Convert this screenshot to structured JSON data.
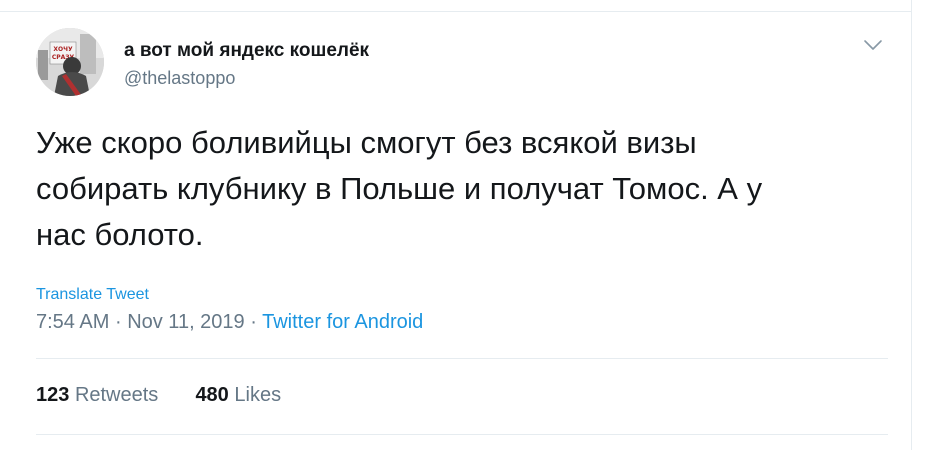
{
  "user": {
    "display_name": "а вот мой яндекс кошелёк",
    "handle": "@thelastoppo",
    "avatar_sign_text": "ХОЧУ СРАЗУ"
  },
  "tweet": {
    "lines": [
      "Уже скоро боливийцы смогут без всякой визы",
      "собирать клубнику в Польше и получат Томос. А у",
      "нас болото."
    ],
    "translate_label": "Translate Tweet",
    "time": "7:54 AM",
    "date": "Nov 11, 2019",
    "separator": "·",
    "source": "Twitter for Android"
  },
  "stats": {
    "retweets_count": "123",
    "retweets_label": "Retweets",
    "likes_count": "480",
    "likes_label": "Likes"
  },
  "icons": {
    "menu": "chevron-down-icon"
  },
  "colors": {
    "link": "#1b95e0",
    "muted": "#657786",
    "text": "#14171a",
    "rule": "#e6ecf0"
  }
}
